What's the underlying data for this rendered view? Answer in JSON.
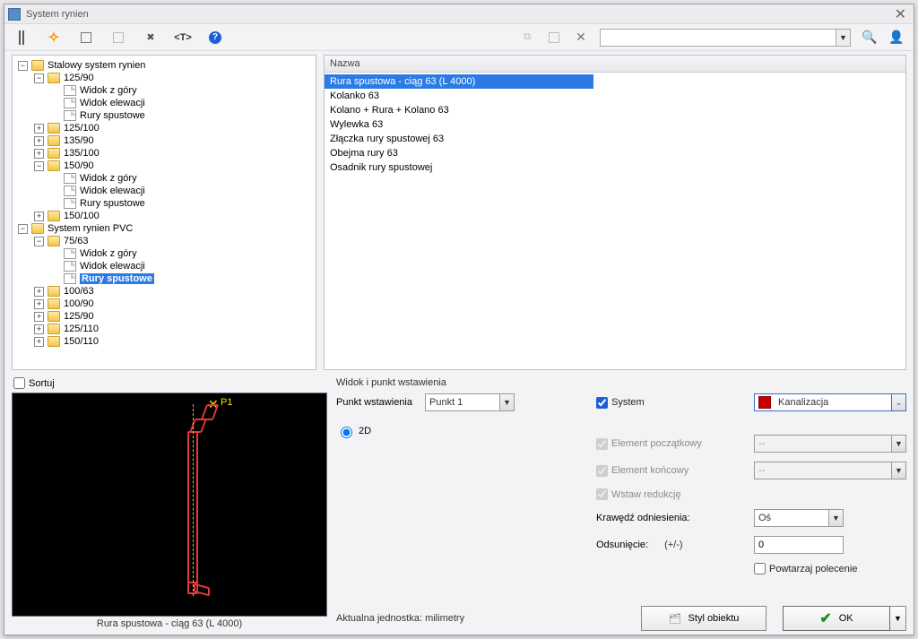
{
  "window": {
    "title": "System rynien"
  },
  "toolbar": {
    "icons": [
      "pipe",
      "plus",
      "grid",
      "grid2",
      "tools",
      "tag",
      "help"
    ],
    "right_icons": [
      "copy",
      "grid3",
      "delete"
    ]
  },
  "search": {
    "value": ""
  },
  "tree": {
    "root1": "Stalowy system rynien",
    "r1_a": "125/90",
    "r1_a_1": "Widok z góry",
    "r1_a_2": "Widok elewacji",
    "r1_a_3": "Rury spustowe",
    "r1_b": "125/100",
    "r1_c": "135/90",
    "r1_d": "135/100",
    "r1_e": "150/90",
    "r1_e_1": "Widok z góry",
    "r1_e_2": "Widok elewacji",
    "r1_e_3": "Rury spustowe",
    "r1_f": "150/100",
    "root2": "System rynien PVC",
    "r2_a": "75/63",
    "r2_a_1": "Widok z góry",
    "r2_a_2": "Widok elewacji",
    "r2_a_3": "Rury spustowe",
    "r2_b": "100/63",
    "r2_c": "100/90",
    "r2_d": "125/90",
    "r2_e": "125/110",
    "r2_f": "150/110"
  },
  "list": {
    "header": "Nazwa",
    "items": [
      "Rura spustowa - ciąg 63 (L 4000)",
      "Kolanko 63",
      "Kolano + Rura + Kolano 63",
      "Wylewka 63",
      "Złączka rury spustowej 63",
      "Obejma rury 63",
      "Osadnik rury spustowej"
    ]
  },
  "preview": {
    "sort_label": "Sortuj",
    "caption": "Rura spustowa - ciąg 63 (L 4000)",
    "point_label": "P1"
  },
  "props": {
    "title": "Widok i punkt wstawienia",
    "insert_point_label": "Punkt wstawienia",
    "insert_point_value": "Punkt 1",
    "mode_2d": "2D",
    "system_label": "System",
    "system_value": "Kanalizacja",
    "start_el_label": "Element początkowy",
    "start_el_value": "--",
    "end_el_label": "Element końcowy",
    "end_el_value": "--",
    "reducer_label": "Wstaw redukcję",
    "ref_edge_label": "Krawędź odniesienia:",
    "ref_edge_value": "Oś",
    "offset_label": "Odsunięcie:",
    "offset_sign": "(+/-)",
    "offset_value": "0",
    "repeat_label": "Powtarzaj polecenie",
    "unit_label_a": "Aktualna jednostka:",
    "unit_label_b": "milimetry",
    "style_btn": "Styl obiektu",
    "ok_btn": "OK"
  }
}
